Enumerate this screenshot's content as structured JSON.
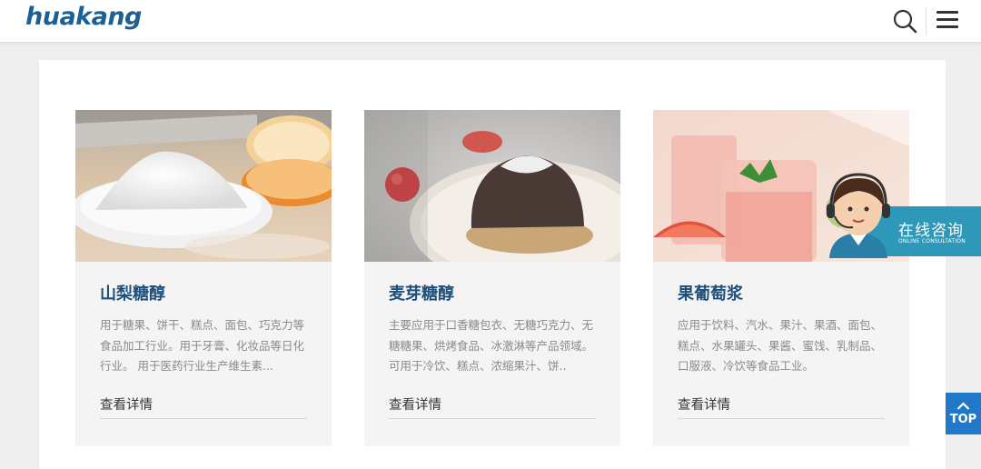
{
  "header": {
    "logo": "huakang",
    "icons": {
      "search": "search-icon",
      "menu": "hamburger-menu-icon"
    }
  },
  "products": [
    {
      "title": "山梨糖醇",
      "desc": "用于糖果、饼干、糕点、面包、巧克力等食品加工行业。用于牙膏、化妆品等日化行业。 用于医药行业生产维生素...",
      "more": "查看详情"
    },
    {
      "title": "麦芽糖醇",
      "desc": "主要应用于口香糖包衣、无糖巧克力、无糖糖果、烘烤食品、冰激淋等产品领域。可用于冷饮、糕点、浓缩果汁、饼..",
      "more": "查看详情"
    },
    {
      "title": "果葡萄浆",
      "desc": "应用于饮料、汽水、果汁、果酒、面包、糕点、水果罐头、果酱、蜜饯、乳制品、口服液、冷饮等食品工业。",
      "more": "查看详情"
    }
  ],
  "consult": {
    "main": "在线咨询",
    "sub": "ONLINE CONSULTATION"
  },
  "top_button": {
    "label": "TOP"
  },
  "colors": {
    "brand": "#1c5f95",
    "title": "#1d4f7d",
    "consult": "#2d98b8",
    "top": "#1f78c8"
  }
}
